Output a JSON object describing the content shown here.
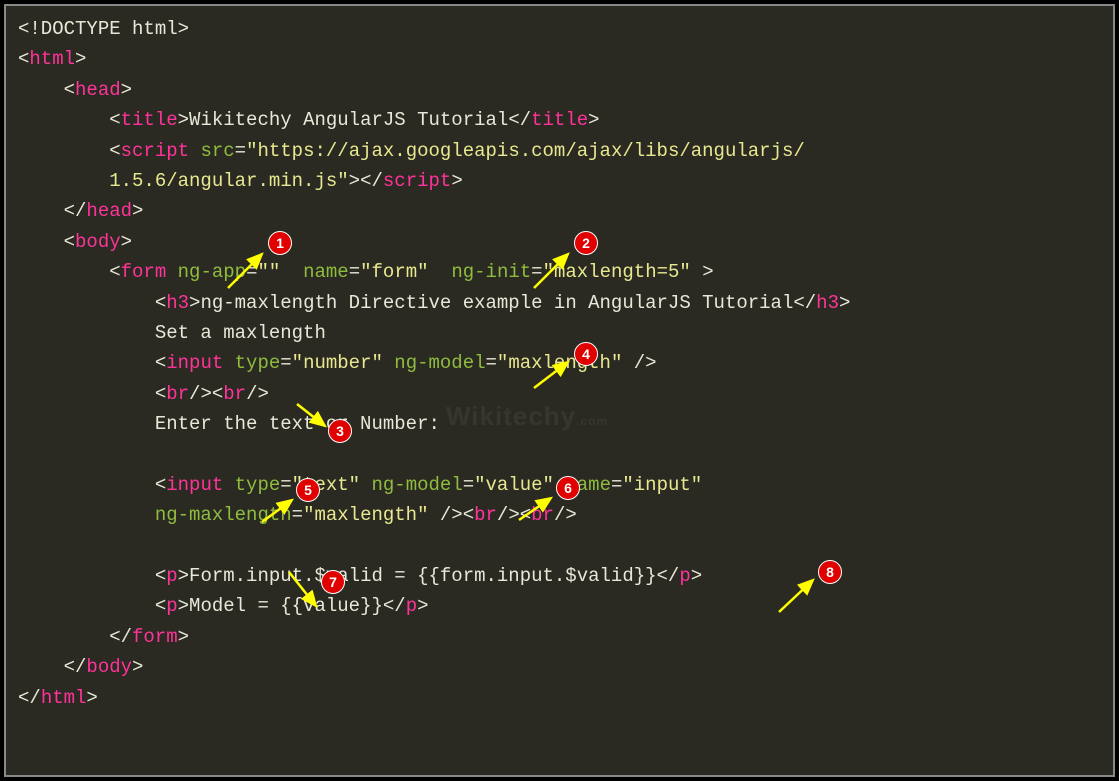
{
  "code": {
    "doctype": "<!DOCTYPE html>",
    "html_open": "html",
    "head_open": "head",
    "title_tag": "title",
    "title_text": "Wikitechy AngularJS Tutorial",
    "script_tag": "script",
    "src_attr": "src",
    "src_val": "\"https://ajax.googleapis.com/ajax/libs/angularjs/",
    "src_val2": "1.5.6/angular.min.js\"",
    "head_close": "head",
    "body_open": "body",
    "form_tag": "form",
    "ngapp_attr": "ng-app",
    "ngapp_val": "\"\"",
    "name_attr": "name",
    "name_val": "\"form\"",
    "nginit_attr": "ng-init",
    "nginit_val": "\"maxlength=5\"",
    "h3_tag": "h3",
    "h3_text": "ng-maxlength Directive example in AngularJS Tutorial",
    "set_text": "Set a maxlength",
    "input_tag": "input",
    "type_attr": "type",
    "type_number": "\"number\"",
    "ngmodel_attr": "ng-model",
    "ngmodel_maxlength": "\"maxlength\"",
    "br_tag": "br",
    "enter_text": "Enter the text or Number:",
    "type_text": "\"text\"",
    "ngmodel_value": "\"value\"",
    "name_input": "\"input\"",
    "ngmaxlength_attr": "ng-maxlength",
    "ngmaxlength_val": "\"maxlength\"",
    "p_tag": "p",
    "p1_text": "Form.input.$valid = {{form.input.$valid}}",
    "p2_text": "Model = {{value}}",
    "form_close": "form",
    "body_close": "body",
    "html_close": "html"
  },
  "badges": {
    "b1": "1",
    "b2": "2",
    "b3": "3",
    "b4": "4",
    "b5": "5",
    "b6": "6",
    "b7": "7",
    "b8": "8"
  },
  "watermark": "Wikitechy"
}
